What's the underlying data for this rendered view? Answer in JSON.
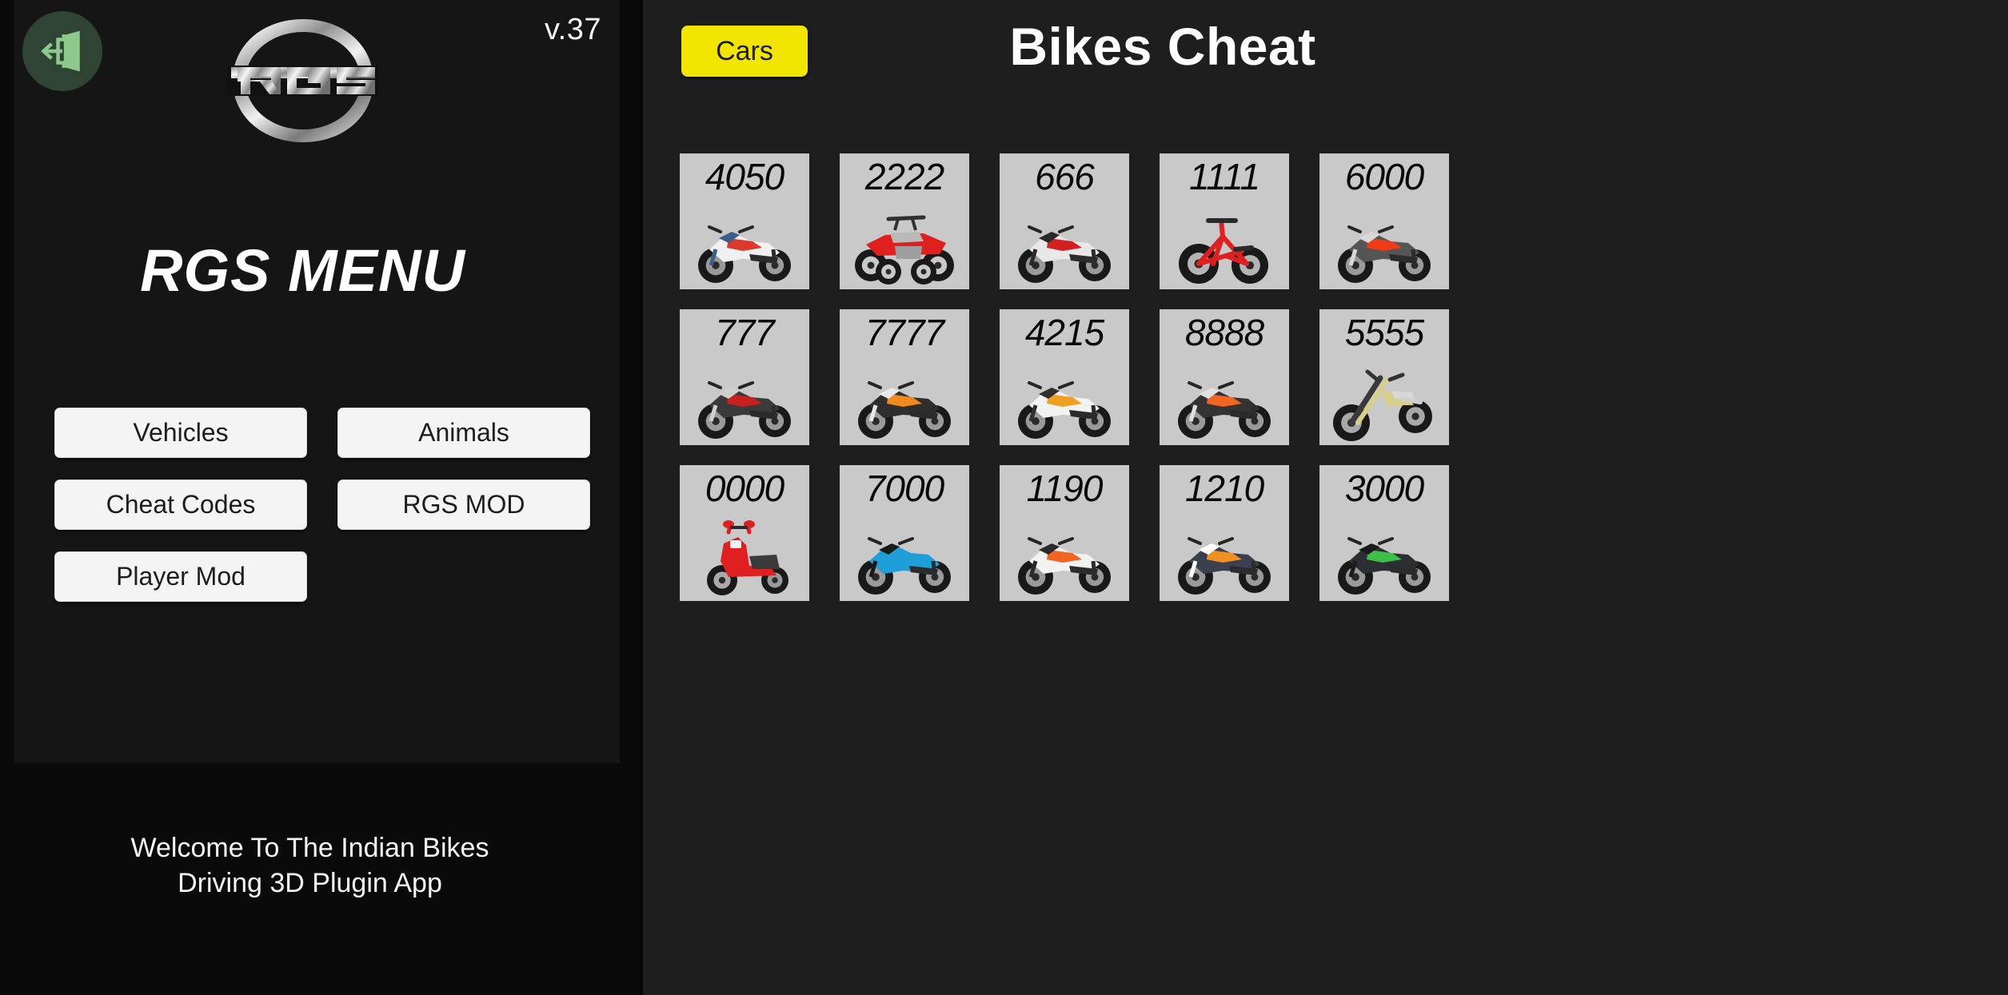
{
  "sidebar": {
    "exit_icon": "exit-door-arrow-icon",
    "version": "v.37",
    "logo_text": "RGS",
    "menu_title": "RGS MENU",
    "buttons": [
      {
        "label": "Vehicles"
      },
      {
        "label": "Animals"
      },
      {
        "label": "Cheat Codes"
      },
      {
        "label": "RGS MOD"
      },
      {
        "label": "Player Mod"
      }
    ],
    "welcome_line1": "Welcome To The Indian Bikes",
    "welcome_line2": "Driving 3D Plugin App"
  },
  "main": {
    "cars_button": "Cars",
    "title": "Bikes Cheat",
    "cards": [
      {
        "code": "4050",
        "vehicle": "sport-bike-white",
        "body": "#f0f0f0",
        "accent": "#d93a2b",
        "trim": "#3a5f8a",
        "type": "sport"
      },
      {
        "code": "2222",
        "vehicle": "quad-atv-red",
        "body": "#e01f1f",
        "accent": "#c9c9c9",
        "trim": "#e01f1f",
        "type": "quad"
      },
      {
        "code": "666",
        "vehicle": "naked-bike-white",
        "body": "#e8e8e8",
        "accent": "#d02020",
        "trim": "#2a2a2a",
        "type": "sport"
      },
      {
        "code": "1111",
        "vehicle": "bmx-bicycle-red",
        "body": "#e02020",
        "accent": "#e02020",
        "trim": "#202020",
        "type": "bicycle"
      },
      {
        "code": "6000",
        "vehicle": "concept-bike-red",
        "body": "#555555",
        "accent": "#ef3b18",
        "trim": "#d8d8d8",
        "type": "sport"
      },
      {
        "code": "777",
        "vehicle": "cruiser-black",
        "body": "#3a3a3a",
        "accent": "#c81f1f",
        "trim": "#d0d0d0",
        "type": "sport"
      },
      {
        "code": "7777",
        "vehicle": "duke-orange",
        "body": "#2e2e2e",
        "accent": "#f08a1e",
        "trim": "#e8e8e8",
        "type": "sport"
      },
      {
        "code": "4215",
        "vehicle": "supermoto-white",
        "body": "#f2f2f2",
        "accent": "#f0a020",
        "trim": "#303030",
        "type": "sport"
      },
      {
        "code": "8888",
        "vehicle": "duke-orange-big",
        "body": "#333333",
        "accent": "#f26422",
        "trim": "#e0e0e0",
        "type": "sport"
      },
      {
        "code": "5555",
        "vehicle": "chopper-gold",
        "body": "#d8cf8a",
        "accent": "#cfc47c",
        "trim": "#3a3a3a",
        "type": "chopper"
      },
      {
        "code": "0000",
        "vehicle": "scooter-red",
        "body": "#e02020",
        "accent": "#3a3a3a",
        "trim": "#d0d0d0",
        "type": "scooter"
      },
      {
        "code": "7000",
        "vehicle": "hayabusa-blue",
        "body": "#1e9fd8",
        "accent": "#1e9fd8",
        "trim": "#1a1a1a",
        "type": "sport"
      },
      {
        "code": "1190",
        "vehicle": "rc8-white-orange",
        "body": "#f2f2f2",
        "accent": "#f26422",
        "trim": "#2a2a2a",
        "type": "sport"
      },
      {
        "code": "1210",
        "vehicle": "rc-orange-black",
        "body": "#3a4050",
        "accent": "#f09020",
        "trim": "#ffffff",
        "type": "sport"
      },
      {
        "code": "3000",
        "vehicle": "ninja-h2-dark",
        "body": "#2b2f33",
        "accent": "#3fbf4a",
        "trim": "#1a1a1a",
        "type": "sport"
      }
    ]
  },
  "colors": {
    "sidebar_bg": "#151515",
    "main_bg": "#1e1e1e",
    "card_bg": "#c9c9c9",
    "cars_button": "#f2e500",
    "exit_badge": "#2f4434",
    "exit_glyph": "#8dc98d",
    "button_face": "#f4f4f4"
  }
}
